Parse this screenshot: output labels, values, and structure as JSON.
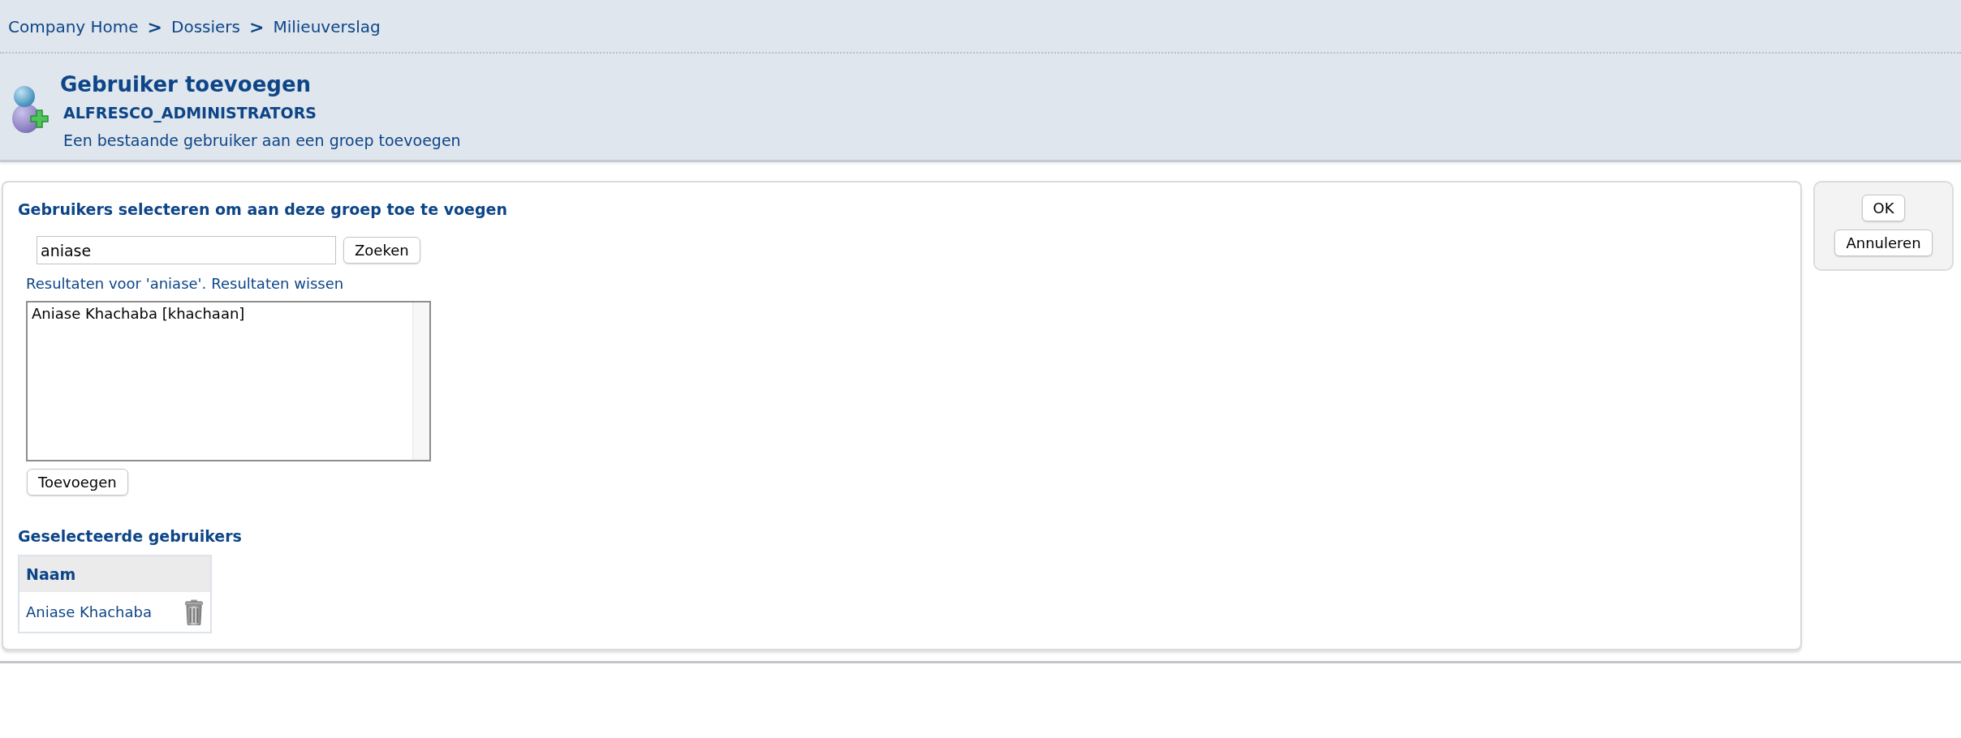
{
  "breadcrumb": [
    {
      "label": "Company Home",
      "separator": ">"
    },
    {
      "label": "Dossiers",
      "separator": ">"
    },
    {
      "label": "Milieuverslag"
    }
  ],
  "header": {
    "title": "Gebruiker toevoegen",
    "group": "ALFRESCO_ADMINISTRATORS",
    "description": "Een bestaande gebruiker aan een groep toevoegen"
  },
  "select_section": {
    "heading": "Gebruikers selecteren om aan deze groep toe te voegen",
    "search": {
      "value": "aniase"
    },
    "search_button": "Zoeken",
    "results_label": "Resultaten voor 'aniase'.",
    "clear_link": "Resultaten wissen",
    "results": [
      {
        "label": "Aniase Khachaba [khachaan]",
        "selected": false
      }
    ],
    "add_button": "Toevoegen"
  },
  "selected_section": {
    "heading": "Geselecteerde gebruikers",
    "table": {
      "columns": [
        "Naam"
      ],
      "rows": [
        {
          "name": "Aniase Khachaba"
        }
      ]
    }
  },
  "actions": {
    "buttons": [
      {
        "label": "OK"
      },
      {
        "label": "Annuleren"
      }
    ]
  }
}
